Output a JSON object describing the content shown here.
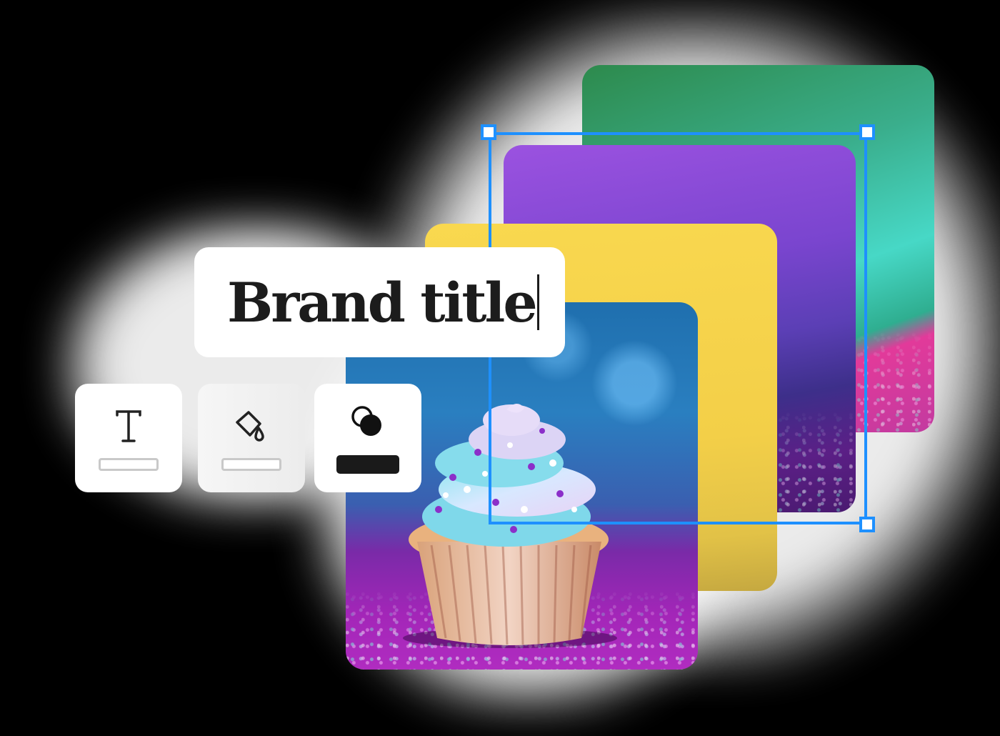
{
  "title_editor": {
    "text": "Brand title"
  },
  "toolbar": {
    "tools": [
      {
        "icon": "text-icon",
        "active": false
      },
      {
        "icon": "paint-bucket-icon",
        "active": false
      },
      {
        "icon": "shapes-icon",
        "active": true
      }
    ]
  },
  "colors": {
    "selection": "#1e90ff",
    "card_green": "#47d8c6",
    "card_purple": "#9b52e0",
    "card_yellow": "#f9d84f",
    "card_cupcake": "#2a7fc0"
  }
}
